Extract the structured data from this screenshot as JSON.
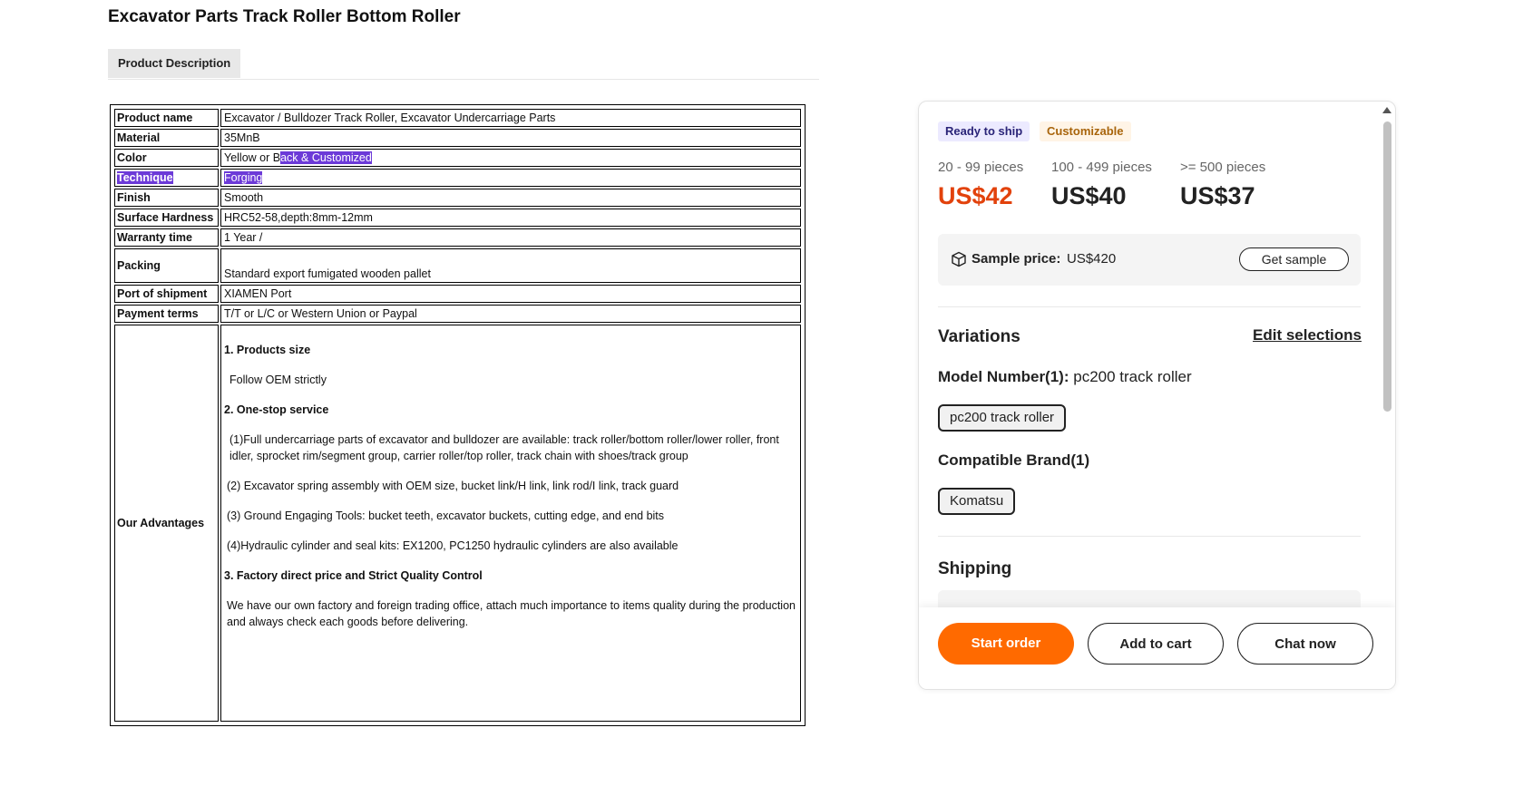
{
  "page": {
    "title": "Excavator Parts Track Roller Bottom Roller",
    "tab": "Product Description"
  },
  "specs": {
    "product_name": {
      "key": "Product name",
      "value": "Excavator / Bulldozer Track Roller, Excavator Undercarriage Parts"
    },
    "material": {
      "key": "Material",
      "value": "35MnB"
    },
    "color": {
      "key": "Color",
      "value_a": "Yellow or B",
      "value_b": "ack & Customized"
    },
    "technique": {
      "key": "Technique",
      "value": "Forging"
    },
    "finish": {
      "key": "Finish",
      "value": "Smooth"
    },
    "surface": {
      "key": "Surface Hardness",
      "value": "HRC52-58,depth:8mm-12mm"
    },
    "warranty": {
      "key": "Warranty time",
      "value": "1 Year /"
    },
    "packing": {
      "key": "Packing",
      "value": "Standard export fumigated wooden pallet"
    },
    "port": {
      "key": "Port of shipment",
      "value": "XIAMEN Port"
    },
    "payment": {
      "key": "Payment terms",
      "value": "T/T or L/C or Western Union or Paypal"
    },
    "advantages": {
      "key": "Our Advantages",
      "h1": "1. Products size",
      "p1": "Follow OEM strictly",
      "h2": "2. One-stop service",
      "p2": "(1)Full undercarriage parts of excavator and bulldozer are available: track roller/bottom roller/lower roller, front idler, sprocket rim/segment group, carrier roller/top roller, track chain with shoes/track group",
      "p3": "(2) Excavator spring assembly with OEM size, bucket link/H link, link rod/I link, track guard",
      "p4": "(3) Ground Engaging Tools: bucket teeth, excavator buckets, cutting edge, and end bits",
      "p5": "(4)Hydraulic cylinder and seal kits: EX1200, PC1250 hydraulic cylinders are also available",
      "h3": "3. Factory direct price and Strict Quality Control",
      "p6": "We have our own factory and foreign trading office, attach much importance to items quality during the production and always check each goods before delivering."
    }
  },
  "order_card": {
    "badges": [
      "Ready to ship",
      "Customizable"
    ],
    "tiers": [
      {
        "qty": "20 - 99 pieces",
        "price": "US$42"
      },
      {
        "qty": "100 - 499 pieces",
        "price": "US$40"
      },
      {
        "qty": ">= 500 pieces",
        "price": "US$37"
      }
    ],
    "sample": {
      "label": "Sample price:",
      "value": "US$420",
      "button": "Get sample"
    },
    "variations": {
      "title": "Variations",
      "edit": "Edit selections",
      "model_label": "Model Number(1):",
      "model_value": "pc200 track roller",
      "model_chip": "pc200 track roller",
      "brand_label": "Compatible Brand(1)",
      "brand_chip": "Komatsu"
    },
    "shipping": {
      "title": "Shipping"
    },
    "actions": {
      "start": "Start order",
      "cart": "Add to cart",
      "chat": "Chat now"
    }
  },
  "colors": {
    "accent_orange": "#ff6a00",
    "price_red": "#e2420c",
    "selection": "#6c3ad8"
  }
}
